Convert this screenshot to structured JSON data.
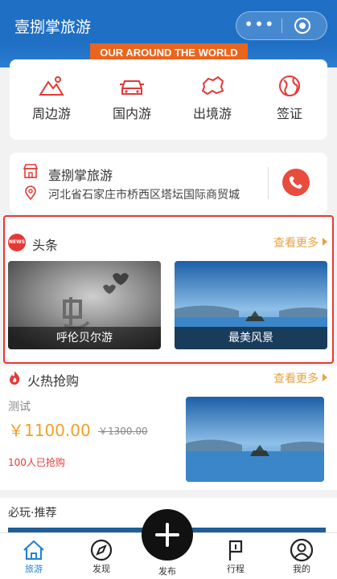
{
  "app": {
    "title": "壹捌掌旅游",
    "more_icon": "more-dots-icon",
    "close_icon": "target-close-icon"
  },
  "banner": {
    "text": "OUR AROUND THE WORLD"
  },
  "categories": [
    {
      "label": "周边游",
      "icon": "mountain-icon"
    },
    {
      "label": "国内游",
      "icon": "car-icon"
    },
    {
      "label": "出境游",
      "icon": "map-icon"
    },
    {
      "label": "签证",
      "icon": "globe-icon"
    }
  ],
  "shop": {
    "name": "壹捌掌旅游",
    "address": "河北省石家庄市桥西区塔坛国际商贸城",
    "phone_icon": "phone-icon"
  },
  "news": {
    "badge": "NEWS",
    "title": "头条",
    "more": "查看更多",
    "items": [
      {
        "caption": "呼伦贝尔游"
      },
      {
        "caption": "最美风景"
      }
    ]
  },
  "hot": {
    "title": "火热抢购",
    "more": "查看更多",
    "product": {
      "name": "测试",
      "price": "￥1100.00",
      "original_price": "￥1300.00",
      "sold": "100人已抢购"
    }
  },
  "recommend": {
    "title": "必玩·推荐"
  },
  "colors": {
    "primary": "#1f6fc4",
    "accent_red": "#e53935",
    "accent_orange": "#f0a028",
    "active_tab": "#2383d6"
  },
  "tabbar": {
    "tabs": [
      {
        "label": "旅游",
        "icon": "home-icon",
        "active": true
      },
      {
        "label": "发现",
        "icon": "compass-icon"
      },
      {
        "label": "发布",
        "icon": "plus-icon"
      },
      {
        "label": "行程",
        "icon": "flag-icon"
      },
      {
        "label": "我的",
        "icon": "user-icon"
      }
    ]
  }
}
